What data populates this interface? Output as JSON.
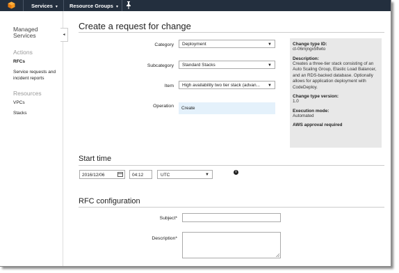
{
  "topbar": {
    "nav": [
      {
        "label": "Services",
        "chevron": "▾"
      },
      {
        "label": "Resource Groups",
        "chevron": "▾"
      }
    ],
    "pin_icon": "pin-icon"
  },
  "sidebar": {
    "title": "Managed Services",
    "sections": [
      {
        "heading": "Actions",
        "items": [
          "RFCs",
          "Service requests and incident reports"
        ]
      },
      {
        "heading": "Resources",
        "items": [
          "VPCs",
          "Stacks"
        ]
      }
    ],
    "collapse": "◂"
  },
  "main": {
    "title": "Create a request for change",
    "form": {
      "category": {
        "label": "Category",
        "value": "Deployment"
      },
      "subcategory": {
        "label": "Subcategory",
        "value": "Standard Stacks"
      },
      "item": {
        "label": "Item",
        "value": "High availability two tier stack (advan..."
      },
      "operation": {
        "label": "Operation",
        "value": "Create"
      }
    },
    "info_panel": {
      "change_type_id_label": "Change type ID:",
      "change_type_id": "ct-06mjngx5flwto",
      "description_label": "Description:",
      "description": "Creates a three-tier stack consisting of an Auto Scaling Group, Elastic Load Balancer, and an RDS-backed database. Optionally allows for application deployment with CodeDeploy.",
      "version_label": "Change type version:",
      "version": "1.0",
      "mode_label": "Execution mode:",
      "mode": "Automated",
      "approval": "AWS approval required"
    },
    "start_time": {
      "title": "Start time",
      "date": "2016/12/06",
      "time": "04:12",
      "timezone": "UTC"
    },
    "rfc_config": {
      "title": "RFC configuration",
      "subject_label": "Subject*",
      "description_label": "Description*"
    }
  },
  "colors": {
    "topbar": "#232f3e",
    "info_bg": "#e8e8e8",
    "operation_bg": "#e4f1fb"
  }
}
